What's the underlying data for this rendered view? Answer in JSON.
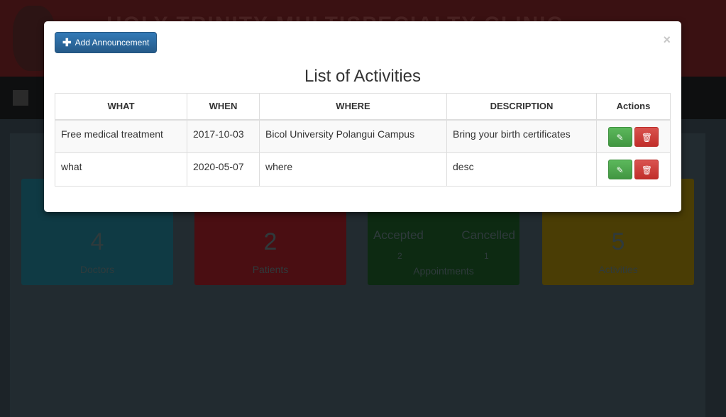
{
  "background": {
    "header_title": "HOLY TRINITY MULTISPECIALTY CLINIC",
    "cards": [
      {
        "number": "4",
        "label": "Doctors",
        "color": "#0f3a44"
      },
      {
        "number": "2",
        "label": "Patients",
        "color": "#4a0e12"
      },
      {
        "accepted_label": "Accepted",
        "accepted": "2",
        "cancelled_label": "Cancelled",
        "cancelled": "1",
        "label": "Appointments",
        "color": "#0d2a12"
      },
      {
        "number": "5",
        "label": "Activities",
        "color": "#4a3d05"
      }
    ]
  },
  "modal": {
    "add_button": "Add Announcement",
    "close": "×",
    "title": "List of Activities",
    "columns": [
      "WHAT",
      "WHEN",
      "WHERE",
      "DESCRIPTION",
      "Actions"
    ],
    "rows": [
      {
        "what": "Free medical treatment",
        "when": "2017-10-03",
        "where": "Bicol University Polangui Campus",
        "description": "Bring your birth certificates"
      },
      {
        "what": "what",
        "when": "2020-05-07",
        "where": "where",
        "description": "desc"
      }
    ]
  }
}
